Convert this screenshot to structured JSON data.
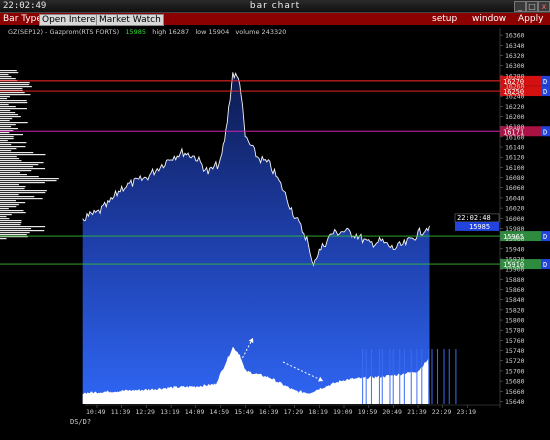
{
  "window": {
    "clock": "22:02:49",
    "title": "bar chart",
    "controls": [
      "_",
      "□",
      "x"
    ]
  },
  "toolbar": {
    "bar_type_label": "Bar Type",
    "open_interest_label": "Open Interest",
    "market_watch_label": "Market Watch",
    "setup_label": "setup",
    "window_label": "window",
    "apply_label": "Apply"
  },
  "info": {
    "symbol": "GZ(SEP12) - Gazprom(RTS FORTS)",
    "last": "15985",
    "high": "high 16287",
    "low": "low 15904",
    "volume": "volume 243320"
  },
  "footer": {
    "note": "DS/D?"
  },
  "colors": {
    "toolbar": "#8b0000",
    "price_fill_top": "#0d1a4d",
    "price_fill_bottom": "#2a5cf0",
    "red_level": "#ff2a2a",
    "magenta_level": "#cc22aa",
    "green_level": "#33bb33",
    "blue_tag": "#2244dd"
  },
  "chart_data": {
    "type": "area",
    "title": "bar chart",
    "symbol": "GZ(SEP12) - Gazprom(RTS FORTS)",
    "x_tick_labels": [
      "10:49",
      "11:39",
      "12:29",
      "13:19",
      "14:09",
      "14:59",
      "15:49",
      "16:39",
      "17:29",
      "18:19",
      "19:09",
      "19:59",
      "20:49",
      "21:39",
      "22:29",
      "23:19"
    ],
    "y_tick_labels": [
      "15640",
      "15660",
      "15680",
      "15700",
      "15720",
      "15740",
      "15760",
      "15780",
      "15800",
      "15820",
      "15840",
      "15860",
      "15880",
      "15900",
      "15920",
      "15940",
      "15960",
      "15980",
      "16000",
      "16020",
      "16040",
      "16060",
      "16080",
      "16100",
      "16120",
      "16140",
      "16160",
      "16180",
      "16200",
      "16220",
      "16240",
      "16260",
      "16280",
      "16300",
      "16320",
      "16340",
      "16360"
    ],
    "ylim": [
      15635,
      16370
    ],
    "price": {
      "x": [
        "10:20",
        "10:49",
        "11:14",
        "11:39",
        "12:04",
        "12:29",
        "12:54",
        "13:19",
        "13:44",
        "14:09",
        "14:34",
        "14:59",
        "15:10",
        "15:24",
        "15:38",
        "15:49",
        "16:14",
        "16:39",
        "17:04",
        "17:29",
        "17:54",
        "18:04",
        "18:19",
        "18:44",
        "19:09",
        "19:34",
        "19:59",
        "20:24",
        "20:49",
        "21:14",
        "21:39",
        "22:02"
      ],
      "values": [
        16000,
        16010,
        16030,
        16060,
        16070,
        16080,
        16100,
        16120,
        16130,
        16120,
        16090,
        16110,
        16170,
        16285,
        16270,
        16160,
        16120,
        16105,
        16060,
        16005,
        15960,
        15910,
        15935,
        15970,
        15975,
        15968,
        15950,
        15955,
        15940,
        15950,
        15970,
        15985
      ]
    },
    "volume_profile": {
      "note": "horizontal volume-at-price histogram on left edge"
    },
    "lower_volume": {
      "x": [
        "10:20",
        "11:39",
        "12:29",
        "13:19",
        "14:09",
        "14:49",
        "15:10",
        "15:24",
        "15:38",
        "15:49",
        "16:39",
        "17:29",
        "17:59",
        "18:19",
        "19:09",
        "19:59",
        "20:49",
        "21:39",
        "22:02"
      ],
      "relative": [
        0.1,
        0.12,
        0.13,
        0.15,
        0.16,
        0.18,
        0.38,
        0.52,
        0.45,
        0.3,
        0.24,
        0.12,
        0.1,
        0.14,
        0.22,
        0.24,
        0.26,
        0.3,
        0.42
      ]
    },
    "levels": [
      {
        "label": "16270",
        "value": 16270,
        "color": "red",
        "flag": "D"
      },
      {
        "label": "16250",
        "value": 16250,
        "color": "red",
        "flag": "D"
      },
      {
        "label": "16171",
        "value": 16171,
        "color": "magenta",
        "flag": "D"
      },
      {
        "label": "15965",
        "value": 15965,
        "color": "green",
        "flag": "D"
      },
      {
        "label": "15910",
        "value": 15910,
        "color": "green",
        "flag": "D"
      }
    ],
    "last_price": {
      "label": "15985",
      "time": "22:02:48"
    }
  }
}
